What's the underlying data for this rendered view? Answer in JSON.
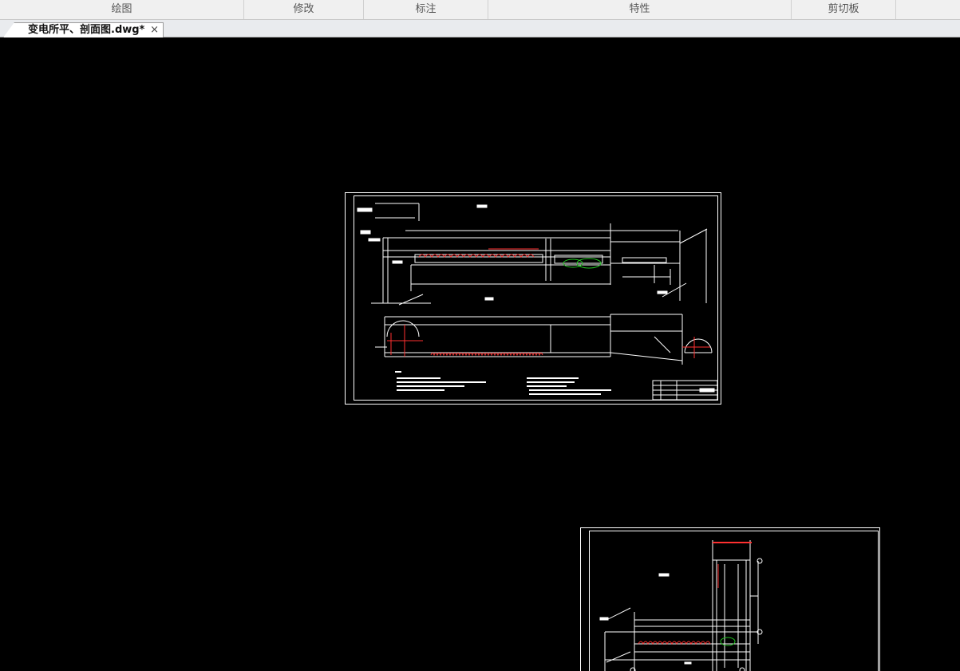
{
  "ribbon": {
    "groups": [
      "绘图",
      "修改",
      "标注",
      "特性",
      "剪切板"
    ]
  },
  "tabs": [
    {
      "label": "变电所平、剖面图.dwg*",
      "close": "×"
    }
  ],
  "colors": {
    "canvas_bg": "#000000",
    "line_white": "#ffffff",
    "line_red": "#ff2020",
    "line_green": "#20c020"
  }
}
